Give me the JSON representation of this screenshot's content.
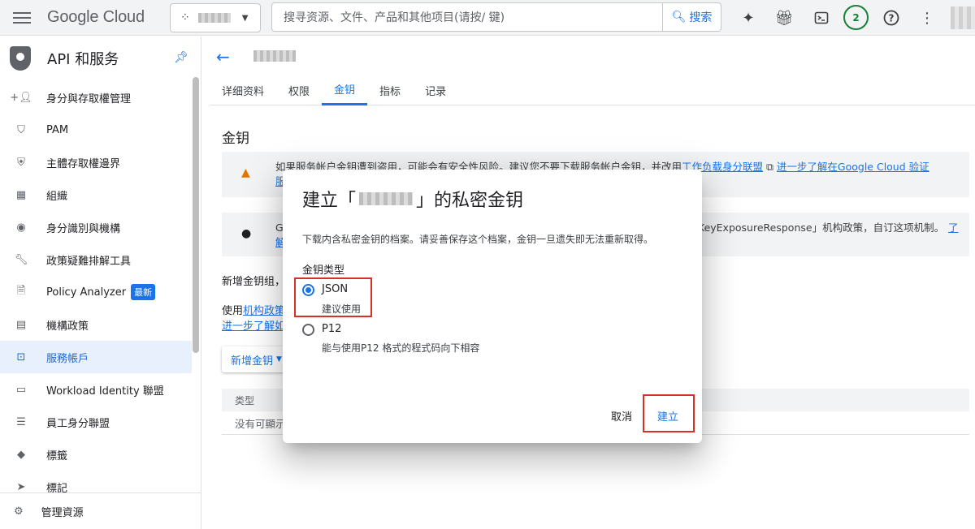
{
  "header": {
    "logo": "Google Cloud",
    "project_selector_icon": "project-dots-icon",
    "search_placeholder": "搜寻资源、文件、产品和其他项目(请按/ 键)",
    "search_button": "搜索",
    "notification_count": "2"
  },
  "sidebar": {
    "title": "API 和服务",
    "items": [
      {
        "label": "身分與存取權管理",
        "icon": "person-add-icon"
      },
      {
        "label": "PAM",
        "icon": "shield-icon"
      },
      {
        "label": "主體存取權邊界",
        "icon": "policy-icon"
      },
      {
        "label": "組織",
        "icon": "building-icon"
      },
      {
        "label": "身分識別與機構",
        "icon": "account-circle-icon"
      },
      {
        "label": "政策疑難排解工具",
        "icon": "wrench-icon"
      },
      {
        "label": "Policy Analyzer",
        "icon": "document-search-icon",
        "tag": "最新"
      },
      {
        "label": "機構政策",
        "icon": "list-box-icon"
      },
      {
        "label": "服務帳戶",
        "icon": "service-account-icon",
        "active": true
      },
      {
        "label": "Workload Identity 聯盟",
        "icon": "id-card-icon"
      },
      {
        "label": "員工身分聯盟",
        "icon": "list-icon"
      },
      {
        "label": "標籤",
        "icon": "tag-icon"
      },
      {
        "label": "標記",
        "icon": "label-icon"
      }
    ],
    "bottom_item": "管理資源"
  },
  "main": {
    "tabs": [
      {
        "label": "详细资料"
      },
      {
        "label": "权限"
      },
      {
        "label": "金钥",
        "active": true
      },
      {
        "label": "指标"
      },
      {
        "label": "记录"
      }
    ],
    "section_title": "金钥",
    "warning_banner": {
      "text": "如果服务帐户金钥遭到盗用，可能会有安全性风险。建议您不要下载服务帐户金钥，并改用",
      "link1": "工作负载身分联盟",
      "link2": "进一步了解在Google Cloud 验证",
      "cont": "服"
    },
    "info_banner": {
      "prefix": "G",
      "text_right": "KeyExposureResponse」机构政策，自订这项机制。",
      "link_right": "了",
      "cont": "解"
    },
    "para1": "新增金钥组，",
    "para2_prefix": "使用",
    "para2_link": "机构政策",
    "para3_link": "进一步了解如",
    "add_key_button": "新增金钥",
    "table_header_type": "类型",
    "table_empty": "没有可顯示"
  },
  "dialog": {
    "title_prefix": "建立「",
    "title_suffix": "」的私密金钥",
    "description": "下载内含私密金钥的档案。请妥善保存这个档案，金钥一旦遗失即无法重新取得。",
    "key_type_label": "金钥类型",
    "options": [
      {
        "label": "JSON",
        "sub": "建议使用",
        "selected": true
      },
      {
        "label": "P12",
        "sub": "能与使用P12 格式的程式码向下相容",
        "selected": false
      }
    ],
    "cancel": "取消",
    "create": "建立"
  },
  "colors": {
    "accent": "#1a73e8",
    "highlight": "#d93025",
    "active_bg": "#e8f0fe"
  }
}
